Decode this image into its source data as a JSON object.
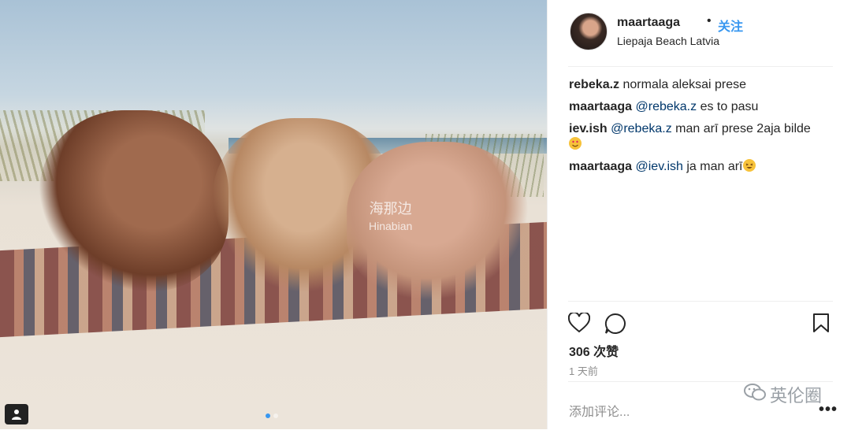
{
  "post": {
    "username": "maartaaga",
    "separator": "•",
    "follow_label": "关注",
    "location": "Liepaja Beach Latvia"
  },
  "comments": [
    {
      "user": "rebeka.z",
      "mention": "",
      "text": "normala aleksai prese"
    },
    {
      "user": "maartaaga",
      "mention": "@rebeka.z",
      "text": "es to pasu"
    },
    {
      "user": "iev.ish",
      "mention": "@rebeka.z",
      "text": "man arī prese 2aja bilde",
      "emoji": "heart-eyes-emoji"
    },
    {
      "user": "maartaaga",
      "mention": "@iev.ish",
      "text": "ja man arī",
      "emoji": "laughing-emoji"
    }
  ],
  "stats": {
    "likes": "306 次赞",
    "time_ago": "1 天前"
  },
  "comment_box": {
    "placeholder": "添加评论...",
    "more": "•••"
  },
  "watermark": {
    "line1": "海那边",
    "line2": "Hinabian",
    "badge": "英伦圈"
  },
  "icons": [
    "heart-icon",
    "comment-icon",
    "bookmark-icon",
    "user-tag-icon",
    "wechat-icon"
  ],
  "carousel": {
    "count": 2,
    "active": 1
  },
  "colors": {
    "accent": "#3897f0",
    "mention": "#00376b",
    "muted": "#8e8e8e"
  }
}
